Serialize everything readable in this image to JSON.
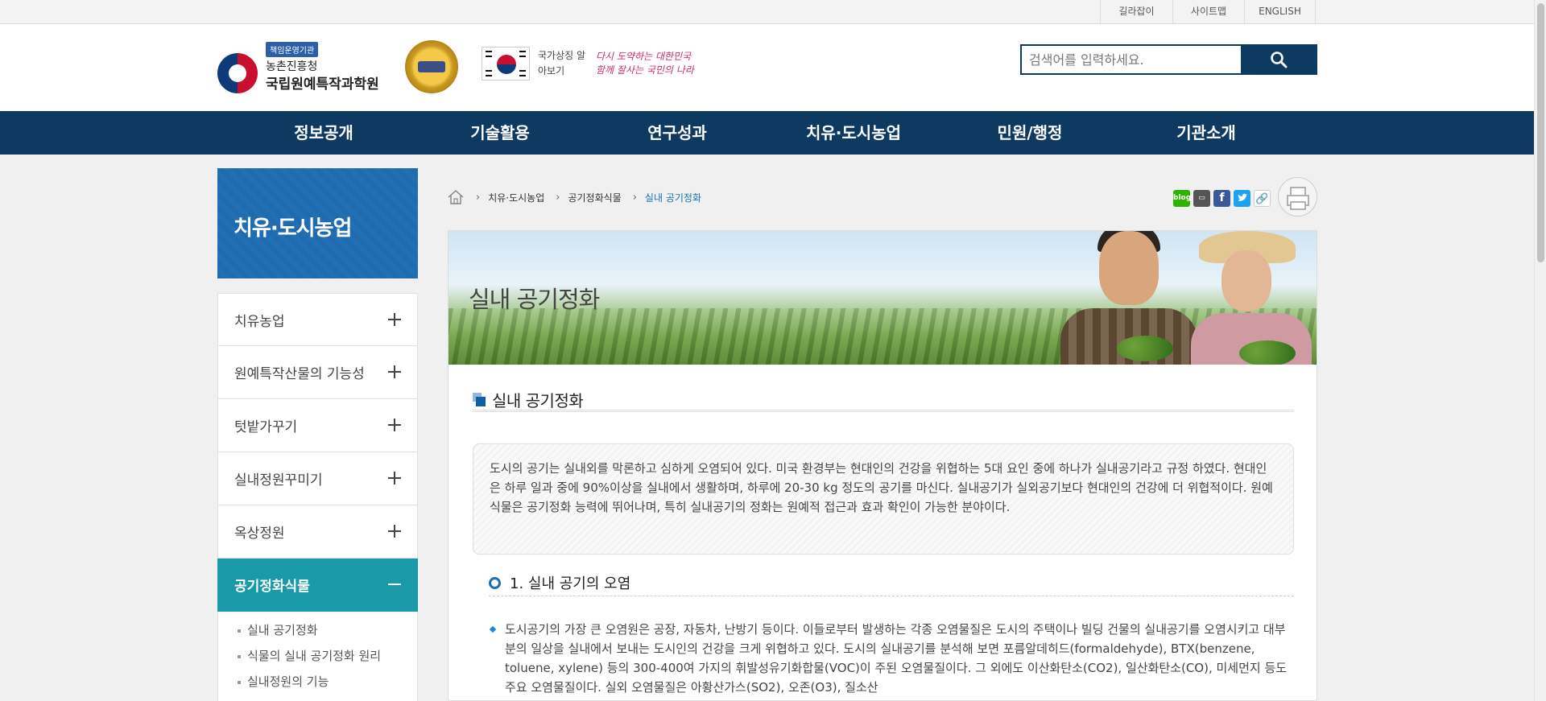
{
  "utility_links": [
    "길라잡이",
    "사이트맵",
    "ENGLISH"
  ],
  "header": {
    "badge": "책임운영기관",
    "org_small": "농촌진흥청",
    "org_big": "국립원예특작과학원",
    "national_symbol": "국가상징 알아보기",
    "slogan": "다시 도약하는 대한민국 함께 잘사는 국민의 나라"
  },
  "search": {
    "placeholder": "검색어를 입력하세요."
  },
  "gnb": [
    "정보공개",
    "기술활용",
    "연구성과",
    "치유·도시농업",
    "민원/행정",
    "기관소개"
  ],
  "sidebar": {
    "title": "치유·도시농업",
    "items": [
      {
        "label": "치유농업",
        "active": false
      },
      {
        "label": "원예특작산물의 기능성",
        "active": false
      },
      {
        "label": "텃밭가꾸기",
        "active": false
      },
      {
        "label": "실내정원꾸미기",
        "active": false
      },
      {
        "label": "옥상정원",
        "active": false
      },
      {
        "label": "공기정화식물",
        "active": true
      }
    ],
    "sub_items": [
      "실내 공기정화",
      "식물의 실내 공기정화 원리",
      "실내정원의 기능"
    ]
  },
  "breadcrumb": [
    "치유·도시농업",
    "공기정화식물",
    "실내 공기정화"
  ],
  "share_icons": [
    "blog-icon",
    "band-icon",
    "facebook-icon",
    "twitter-icon",
    "link-icon"
  ],
  "page": {
    "banner_title": "실내 공기정화",
    "section_title": "실내 공기정화",
    "intro": "도시의 공기는 실내외를 막론하고 심하게 오염되어 있다. 미국 환경부는 현대인의 건강을 위협하는 5대 요인 중에 하나가 실내공기라고 규정 하였다. 현대인은 하루 일과 중에 90%이상을 실내에서 생활하며, 하루에 20-30 kg 정도의 공기를 마신다. 실내공기가 실외공기보다 현대인의 건강에 더 위협적이다. 원예식물은 공기정화 능력에 뛰어나며, 특히 실내공기의 정화는 원예적 접근과 효과 확인이 가능한 분야이다.",
    "h4": "1. 실내 공기의 오염",
    "bullet": "도시공기의 가장 큰 오염원은 공장, 자동차, 난방기 등이다. 이들로부터 발생하는 각종 오염물질은 도시의 주택이나 빌딩 건물의 실내공기를 오염시키고 대부분의 일상을 실내에서 보내는 도시인의 건강을 크게 위협하고 있다. 도시의 실내공기를 분석해 보면 포름알데히드(formaldehyde), BTX(benzene, toluene, xylene) 등의 300-400여 가지의 휘발성유기화합물(VOC)이 주된 오염물질이다. 그 외에도 이산화탄소(CO2), 일산화탄소(CO), 미세먼지 등도 주요 오염물질이다. 실외 오염물질은 아황산가스(SO2), 오존(O3), 질소산"
  },
  "colors": {
    "navy": "#0e3a62",
    "side_blue": "#1f6bb0",
    "teal": "#1a9aa8"
  }
}
